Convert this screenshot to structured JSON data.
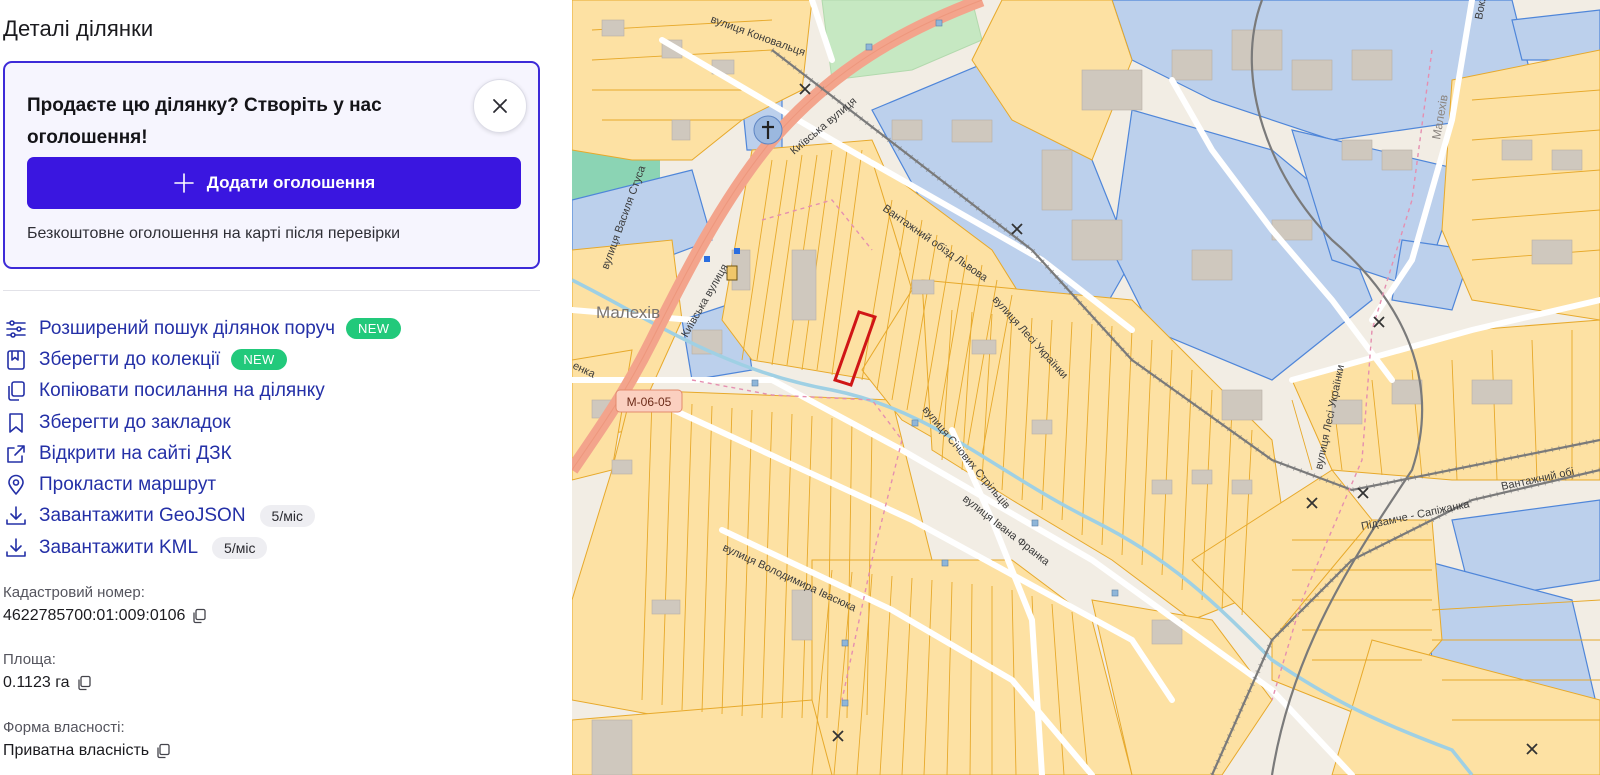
{
  "panel": {
    "title": "Деталі ділянки"
  },
  "promo": {
    "title": "Продаєте цю ділянку? Створіть у нас оголошення!",
    "button_label": "Додати оголошення",
    "note": "Безкоштовне оголошення на карті після перевірки"
  },
  "actions": [
    {
      "label": "Розширений пошук ділянок поруч",
      "icon": "sliders-icon",
      "badge": "NEW"
    },
    {
      "label": "Зберегти до колекції",
      "icon": "collection-icon",
      "badge": "NEW"
    },
    {
      "label": "Копіювати посилання на ділянку",
      "icon": "copy-link-icon"
    },
    {
      "label": "Зберегти до закладок",
      "icon": "bookmark-icon"
    },
    {
      "label": "Відкрити на сайті ДЗК",
      "icon": "external-link-icon"
    },
    {
      "label": "Прокласти маршрут",
      "icon": "map-pin-icon"
    },
    {
      "label": "Завантажити GeoJSON",
      "icon": "download-icon",
      "quota": "5/міс"
    },
    {
      "label": "Завантажити KML",
      "icon": "download-icon",
      "quota": "5/міс"
    }
  ],
  "details": {
    "cadastral": {
      "label": "Кадастровий номер:",
      "value": "4622785700:01:009:0106"
    },
    "area": {
      "label": "Площа:",
      "value": "0.1123 га"
    },
    "ownership": {
      "label": "Форма власності:",
      "value": "Приватна власність"
    }
  },
  "map": {
    "labels": {
      "konovaltsia": "вулиця Коновальця",
      "kyivska": "Київська вулиця",
      "kyivska2": "Київська вулиця",
      "vasylia_stusa": "вулиця Василя Стуса",
      "malekhiv": "Малехів",
      "malekhiv_small": "Малехів",
      "vokzalna": "Вокзальна вулиця",
      "vantazhnyi_obizd": "Вантажний обізд Львова",
      "lesi_ukrainky": "вулиця Лесі Українки",
      "lesi_ukrainky2": "вулиця Лесі Українки",
      "sichovykh_striltsiv": "вулиця Січових Стрільців",
      "ivana_franka": "вулиця Івана Франка",
      "volodymyra_ivasiuka": "вулиця Володимира Івасюка",
      "pidzamche": "Підзамче - Сапіжанка",
      "vantazhnyi_obi": "Вантажний обі",
      "road_ref": "М-06-05",
      "left_edge": "енка"
    },
    "colors": {
      "parcel_fill": "#fde1a3",
      "parcel_stroke": "#e7a92b",
      "industrial_fill": "#bcd0ec",
      "industrial_stroke": "#4f86d9",
      "selected_stroke": "#d01616",
      "main_road": "#f3a48c",
      "water": "#9fd0e4",
      "park": "#c6e8c2",
      "rail": "#7a7a7a"
    }
  }
}
